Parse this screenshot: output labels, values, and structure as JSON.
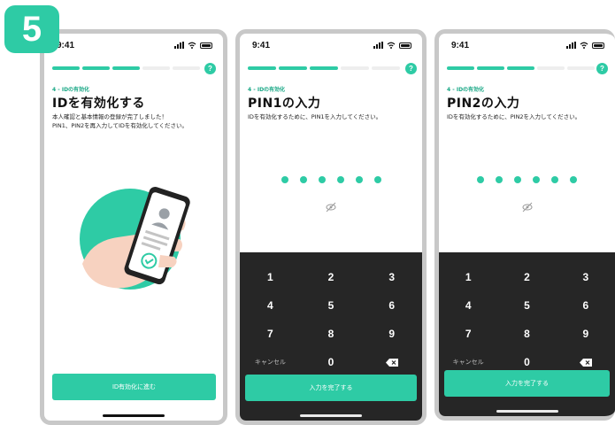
{
  "step_badge": "5",
  "colors": {
    "accent": "#2ecba5",
    "keypad_bg": "#262626",
    "frame": "#c8c8c8"
  },
  "screens": [
    {
      "status_time": "9:41",
      "progress": {
        "total": 5,
        "done": 3
      },
      "help_icon": "?",
      "step_label": "4 - IDの有効化",
      "title": "IDを有効化する",
      "description": "本人確認と基本情報の登録が完了しました！\nPIN1、PIN2を再入力してIDを有効化してください。",
      "illustration": "phone-in-hand-id-card-icon",
      "button_label": "ID有効化に進む"
    },
    {
      "status_time": "9:41",
      "progress": {
        "total": 5,
        "done": 3
      },
      "help_icon": "?",
      "step_label": "4 - IDの有効化",
      "title": "PIN1の入力",
      "description": "IDを有効化するために、PIN1を入力してください。",
      "pin_length": 6,
      "eye_icon": "eye-off-icon",
      "keys": [
        "1",
        "2",
        "3",
        "4",
        "5",
        "6",
        "7",
        "8",
        "9",
        "キャンセル",
        "0",
        "⌫"
      ],
      "button_label": "入力を完了する"
    },
    {
      "status_time": "9:41",
      "progress": {
        "total": 5,
        "done": 3
      },
      "help_icon": "?",
      "step_label": "4 - IDの有効化",
      "title": "PIN2の入力",
      "description": "IDを有効化するために、PIN2を入力してください。",
      "pin_length": 6,
      "eye_icon": "eye-off-icon",
      "keys": [
        "1",
        "2",
        "3",
        "4",
        "5",
        "6",
        "7",
        "8",
        "9",
        "キャンセル",
        "0",
        "⌫"
      ],
      "button_label": "入力を完了する"
    }
  ]
}
